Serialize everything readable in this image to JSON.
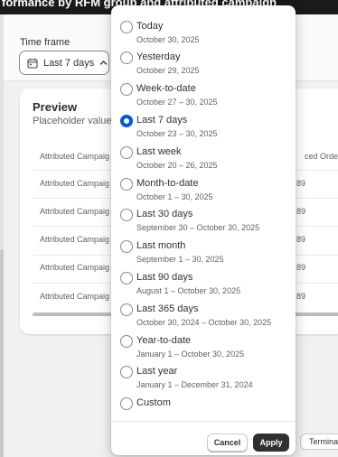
{
  "page": {
    "title": "formance by RFM group and attributed campaign"
  },
  "time_frame": {
    "label": "Time frame",
    "value": "Last 7 days"
  },
  "preview": {
    "title": "Preview",
    "subtitle": "Placeholder values",
    "columns": [
      "Attributed Campaig",
      "ced Order t"
    ],
    "rows": [
      {
        "col1": "Attributed Campaig",
        "col2": "89"
      },
      {
        "col1": "Attributed Campaig",
        "col2": "89"
      },
      {
        "col1": "Attributed Campaig",
        "col2": "89"
      },
      {
        "col1": "Attributed Campaig",
        "col2": "89"
      },
      {
        "col1": "Attributed Campaig",
        "col2": "89"
      }
    ]
  },
  "date_options": [
    {
      "label": "Today",
      "range": "October 30, 2025",
      "selected": false
    },
    {
      "label": "Yesterday",
      "range": "October 29, 2025",
      "selected": false
    },
    {
      "label": "Week-to-date",
      "range": "October 27 – 30, 2025",
      "selected": false
    },
    {
      "label": "Last 7 days",
      "range": "October 23 – 30, 2025",
      "selected": true
    },
    {
      "label": "Last week",
      "range": "October 20 – 26, 2025",
      "selected": false
    },
    {
      "label": "Month-to-date",
      "range": "October 1 – 30, 2025",
      "selected": false
    },
    {
      "label": "Last 30 days",
      "range": "September 30 – October 30, 2025",
      "selected": false
    },
    {
      "label": "Last month",
      "range": "September 1 – 30, 2025",
      "selected": false
    },
    {
      "label": "Last 90 days",
      "range": "August 1 – October 30, 2025",
      "selected": false
    },
    {
      "label": "Last 365 days",
      "range": "October 30, 2024 – October 30, 2025",
      "selected": false
    },
    {
      "label": "Year-to-date",
      "range": "January 1 – October 30, 2025",
      "selected": false
    },
    {
      "label": "Last year",
      "range": "January 1 – December 31, 2024",
      "selected": false
    },
    {
      "label": "Custom",
      "range": "",
      "selected": false
    }
  ],
  "buttons": {
    "cancel": "Cancel",
    "apply": "Apply"
  },
  "terminal": {
    "label": "Terminal"
  },
  "colors": {
    "accent": "#005bd3",
    "topbar": "#1a1a1a",
    "primary_button": "#303030"
  },
  "icons": {
    "time_frame": "calendar-icon",
    "time_frame_toggle": "chevron-up-icon"
  }
}
